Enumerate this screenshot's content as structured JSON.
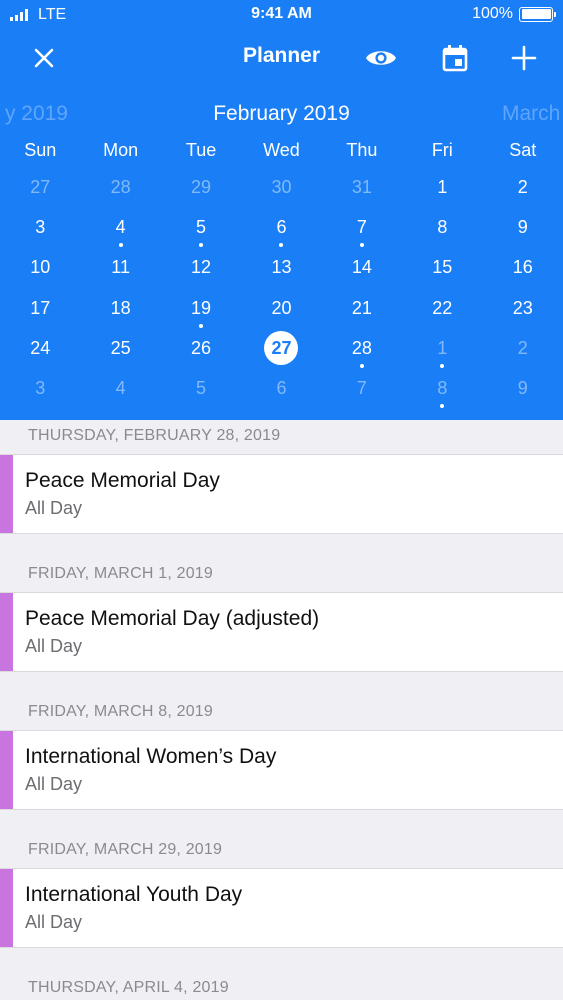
{
  "status": {
    "carrier": "LTE",
    "time": "9:41 AM",
    "battery": "100%"
  },
  "nav": {
    "title": "Planner",
    "close_icon": "close-icon",
    "eye_icon": "eye-icon",
    "calendar_icon": "calendar-icon",
    "add_icon": "plus-icon"
  },
  "months": {
    "prev": "y 2019",
    "current": "February 2019",
    "next": "March"
  },
  "weekdays": [
    "Sun",
    "Mon",
    "Tue",
    "Wed",
    "Thu",
    "Fri",
    "Sat"
  ],
  "calendar": {
    "weeks": [
      [
        {
          "d": "27",
          "out": true
        },
        {
          "d": "28",
          "out": true
        },
        {
          "d": "29",
          "out": true
        },
        {
          "d": "30",
          "out": true
        },
        {
          "d": "31",
          "out": true
        },
        {
          "d": "1"
        },
        {
          "d": "2"
        }
      ],
      [
        {
          "d": "3"
        },
        {
          "d": "4",
          "dot": true
        },
        {
          "d": "5",
          "dot": true
        },
        {
          "d": "6",
          "dot": true
        },
        {
          "d": "7",
          "dot": true
        },
        {
          "d": "8"
        },
        {
          "d": "9"
        }
      ],
      [
        {
          "d": "10"
        },
        {
          "d": "11"
        },
        {
          "d": "12"
        },
        {
          "d": "13"
        },
        {
          "d": "14"
        },
        {
          "d": "15"
        },
        {
          "d": "16"
        }
      ],
      [
        {
          "d": "17"
        },
        {
          "d": "18"
        },
        {
          "d": "19",
          "dot": true
        },
        {
          "d": "20"
        },
        {
          "d": "21"
        },
        {
          "d": "22"
        },
        {
          "d": "23"
        }
      ],
      [
        {
          "d": "24"
        },
        {
          "d": "25"
        },
        {
          "d": "26"
        },
        {
          "d": "27",
          "today": true
        },
        {
          "d": "28",
          "dot": true
        },
        {
          "d": "1",
          "out": true,
          "dot": true
        },
        {
          "d": "2",
          "out": true
        }
      ],
      [
        {
          "d": "3",
          "out": true
        },
        {
          "d": "4",
          "out": true
        },
        {
          "d": "5",
          "out": true
        },
        {
          "d": "6",
          "out": true
        },
        {
          "d": "7",
          "out": true
        },
        {
          "d": "8",
          "out": true,
          "dot": true
        },
        {
          "d": "9",
          "out": true
        }
      ]
    ]
  },
  "agenda": [
    {
      "header": "THURSDAY, FEBRUARY 28, 2019",
      "title": "Peace Memorial Day",
      "sub": "All Day"
    },
    {
      "header": "FRIDAY, MARCH 1, 2019",
      "title": "Peace Memorial Day (adjusted)",
      "sub": "All Day"
    },
    {
      "header": "FRIDAY, MARCH 8, 2019",
      "title": "International Women’s Day",
      "sub": "All Day"
    },
    {
      "header": "FRIDAY, MARCH 29, 2019",
      "title": "International Youth Day",
      "sub": "All Day"
    },
    {
      "header": "THURSDAY, APRIL 4, 2019"
    }
  ],
  "colors": {
    "accent_blue": "#1a7ef6",
    "event_accent": "#c875e0"
  }
}
